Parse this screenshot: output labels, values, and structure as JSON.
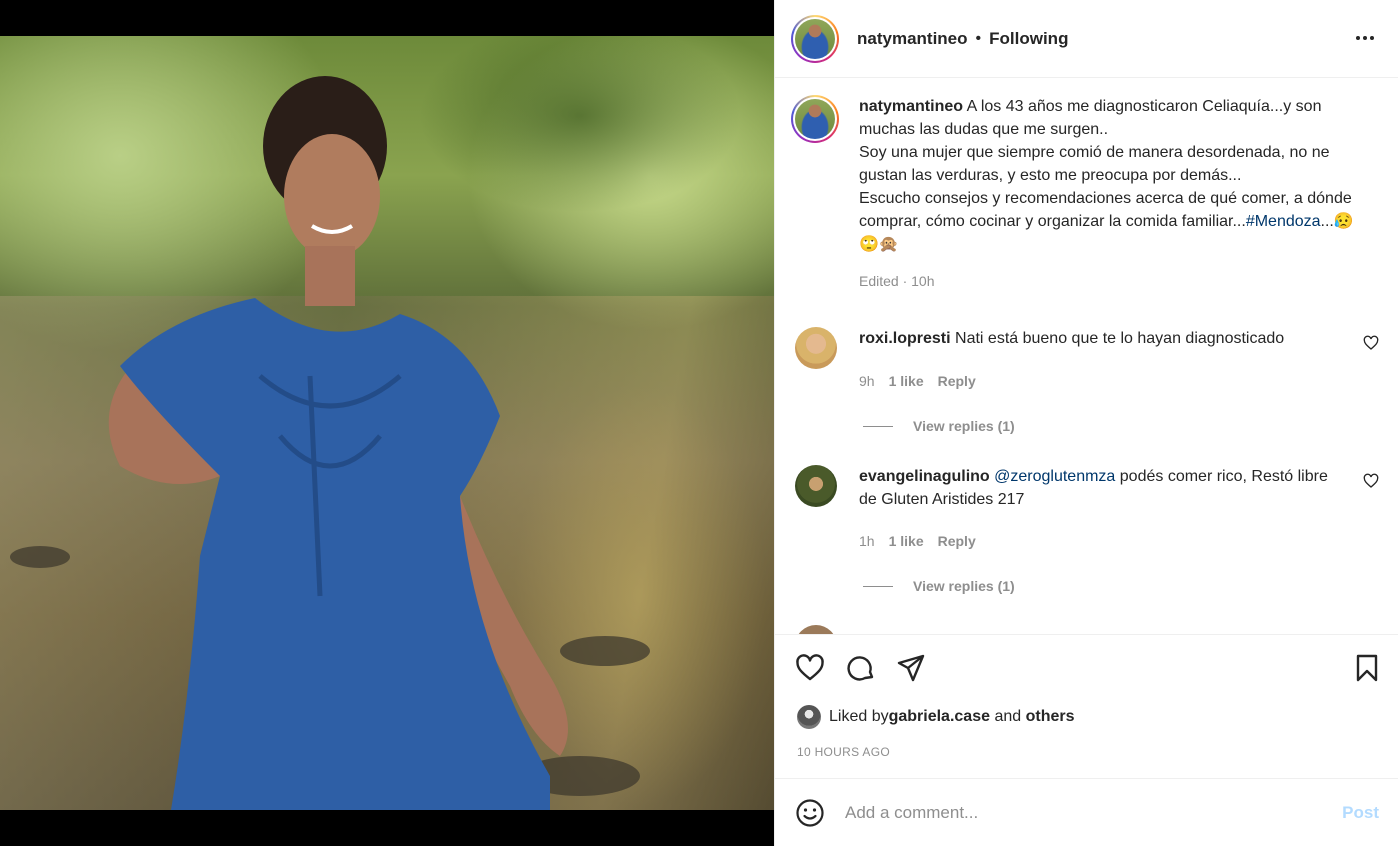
{
  "post": {
    "author": "natymantineo",
    "separator": "•",
    "follow_status": "Following",
    "more_icon": "more-horizontal-icon"
  },
  "caption": {
    "username": "natymantineo",
    "text_main": " A los 43 años me diagnosticaron Celiaquía...y son muchas las dudas que me surgen..",
    "text_line2": "Soy una mujer que siempre comió de manera desordenada, no ne gustan las verduras, y esto me preocupa por demás...",
    "text_line3": "Escucho consejos y recomendaciones acerca de qué comer, a dónde comprar, cómo cocinar y organizar la comida familiar...",
    "hashtag": "#Mendoza",
    "emojis": "...😥🙄🙊",
    "meta": "Edited · 10h"
  },
  "comments": [
    {
      "username": "roxi.lopresti",
      "text": " Nati está bueno que te lo hayan diagnosticado",
      "time": "9h",
      "likes": "1 like",
      "reply": "Reply",
      "view_replies": "View replies (1)"
    },
    {
      "username": "evangelinagulino",
      "mention": "@zeroglutenmza",
      "text": " podés comer rico, Restó libre de Gluten Aristides 217",
      "time": "1h",
      "likes": "1 like",
      "reply": "Reply",
      "view_replies": "View replies (1)"
    }
  ],
  "likes": {
    "prefix": "Liked by ",
    "user": "gabriela.case",
    "middle": " and ",
    "others": "others"
  },
  "timestamp": "10 HOURS AGO",
  "add_comment": {
    "placeholder": "Add a comment...",
    "post_label": "Post"
  },
  "colors": {
    "link": "#00376b",
    "muted": "#8e8e8e",
    "post_disabled": "#b3dbff"
  }
}
